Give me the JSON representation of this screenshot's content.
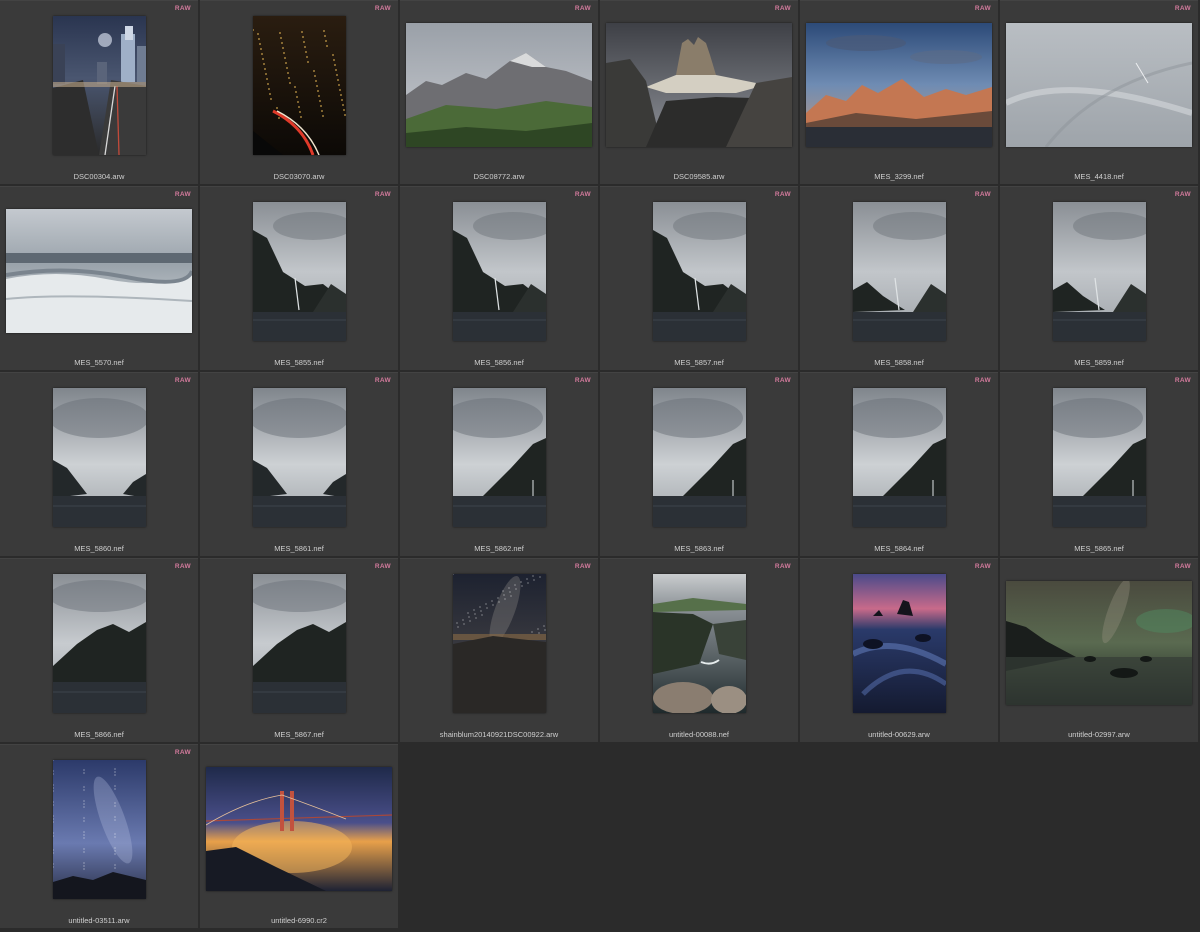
{
  "badge_label": "RAW",
  "items": [
    {
      "filename": "DSC00304.arw",
      "badge": true,
      "orientation": "portrait",
      "scene": "city-freeway",
      "icon": "city-freeway-photo-icon"
    },
    {
      "filename": "DSC03070.arw",
      "badge": true,
      "orientation": "portrait",
      "scene": "city-night",
      "icon": "city-night-photo-icon"
    },
    {
      "filename": "DSC08772.arw",
      "badge": true,
      "orientation": "landscape",
      "scene": "mountain-green",
      "icon": "mountain-valley-photo-icon"
    },
    {
      "filename": "DSC09585.arw",
      "badge": true,
      "orientation": "landscape",
      "scene": "dolomite-peaks",
      "icon": "mountain-peaks-photo-icon"
    },
    {
      "filename": "MES_3299.nef",
      "badge": true,
      "orientation": "landscape",
      "scene": "alpenglow",
      "icon": "mountain-sunset-photo-icon"
    },
    {
      "filename": "MES_4418.nef",
      "badge": true,
      "orientation": "landscape",
      "scene": "snow",
      "icon": "snow-slope-photo-icon"
    },
    {
      "filename": "MES_5570.nef",
      "badge": true,
      "orientation": "landscape",
      "scene": "waves",
      "icon": "ocean-waves-photo-icon"
    },
    {
      "filename": "MES_5855.nef",
      "badge": true,
      "orientation": "portrait",
      "scene": "fjord-left",
      "icon": "fjord-photo-icon"
    },
    {
      "filename": "MES_5856.nef",
      "badge": true,
      "orientation": "portrait",
      "scene": "fjord-left",
      "icon": "fjord-photo-icon"
    },
    {
      "filename": "MES_5857.nef",
      "badge": true,
      "orientation": "portrait",
      "scene": "fjord-left",
      "icon": "fjord-photo-icon"
    },
    {
      "filename": "MES_5858.nef",
      "badge": true,
      "orientation": "portrait",
      "scene": "fjord-left-small",
      "icon": "fjord-photo-icon"
    },
    {
      "filename": "MES_5859.nef",
      "badge": true,
      "orientation": "portrait",
      "scene": "fjord-left-small",
      "icon": "fjord-photo-icon"
    },
    {
      "filename": "MES_5860.nef",
      "badge": true,
      "orientation": "portrait",
      "scene": "fjord-both",
      "icon": "fjord-photo-icon"
    },
    {
      "filename": "MES_5861.nef",
      "badge": true,
      "orientation": "portrait",
      "scene": "fjord-both",
      "icon": "fjord-photo-icon"
    },
    {
      "filename": "MES_5862.nef",
      "badge": true,
      "orientation": "portrait",
      "scene": "fjord-right",
      "icon": "fjord-photo-icon"
    },
    {
      "filename": "MES_5863.nef",
      "badge": true,
      "orientation": "portrait",
      "scene": "fjord-right",
      "icon": "fjord-photo-icon"
    },
    {
      "filename": "MES_5864.nef",
      "badge": true,
      "orientation": "portrait",
      "scene": "fjord-right",
      "icon": "fjord-photo-icon"
    },
    {
      "filename": "MES_5865.nef",
      "badge": true,
      "orientation": "portrait",
      "scene": "fjord-right",
      "icon": "fjord-photo-icon"
    },
    {
      "filename": "MES_5866.nef",
      "badge": true,
      "orientation": "portrait",
      "scene": "fjord-big",
      "icon": "fjord-photo-icon"
    },
    {
      "filename": "MES_5867.nef",
      "badge": true,
      "orientation": "portrait",
      "scene": "fjord-big",
      "icon": "fjord-photo-icon"
    },
    {
      "filename": "shainblum20140921DSC00922.arw",
      "badge": true,
      "orientation": "portrait",
      "scene": "milkyway-desert",
      "icon": "milky-way-photo-icon"
    },
    {
      "filename": "untitled-00088.nef",
      "badge": true,
      "orientation": "portrait",
      "scene": "sea-cliff",
      "icon": "sea-cliff-photo-icon"
    },
    {
      "filename": "untitled-00629.arw",
      "badge": true,
      "orientation": "portrait",
      "scene": "blue-rocks",
      "icon": "seastack-dusk-photo-icon"
    },
    {
      "filename": "untitled-02997.arw",
      "badge": true,
      "orientation": "landscape",
      "scene": "aurora-coast",
      "icon": "night-coast-photo-icon"
    },
    {
      "filename": "untitled-03511.arw",
      "badge": true,
      "orientation": "portrait",
      "scene": "milkyway-blue",
      "icon": "milky-way-photo-icon"
    },
    {
      "filename": "untitled-6990.cr2",
      "badge": false,
      "orientation": "landscape",
      "scene": "golden-gate",
      "icon": "golden-gate-photo-icon"
    }
  ]
}
